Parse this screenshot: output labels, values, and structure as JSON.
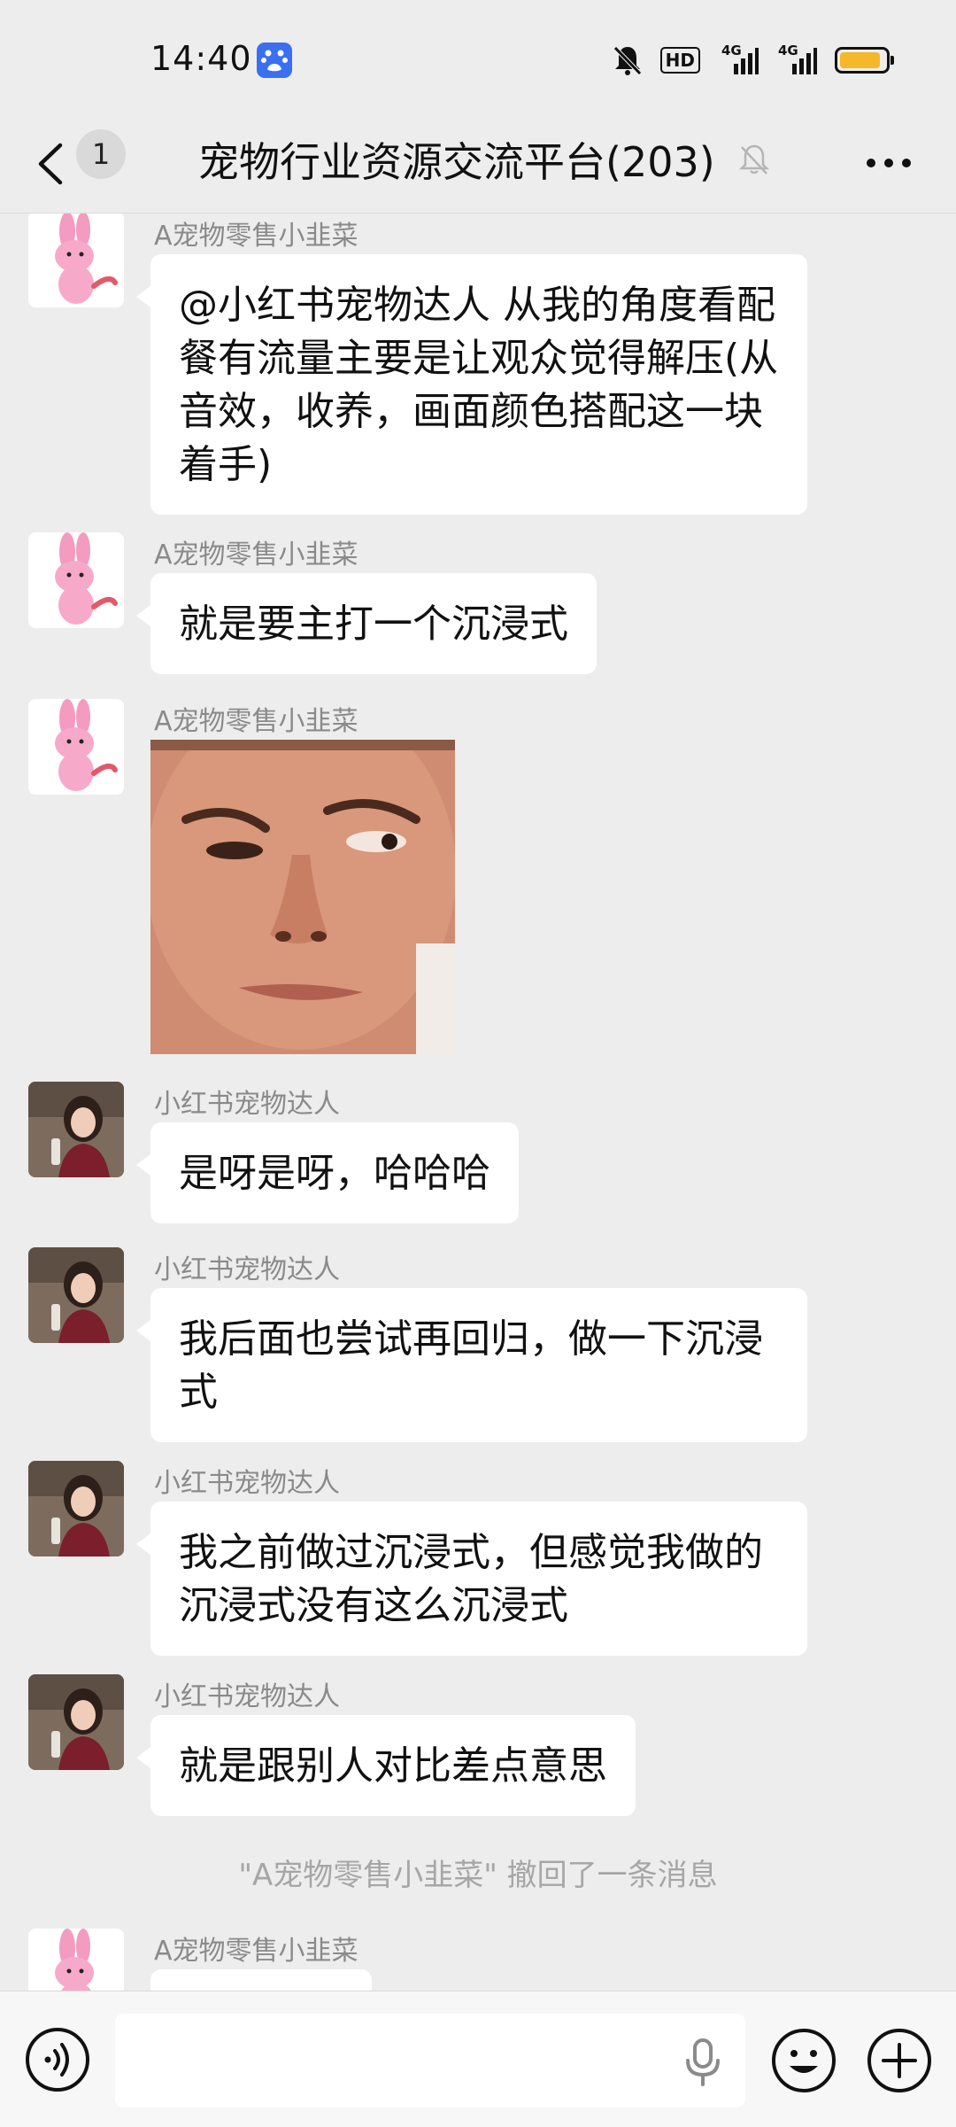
{
  "status_bar": {
    "time": "14:40",
    "hd_label": "HD",
    "network_1": "4G",
    "network_2": "4G",
    "battery_level": 0.9,
    "battery_color": "#f5b82a"
  },
  "header": {
    "unread_count": "1",
    "title": "宠物行业资源交流平台(203)",
    "muted": true
  },
  "messages": [
    {
      "sender": "A宠物零售小韭菜",
      "avatar": "pink-rabbit",
      "text": "@小红书宠物达人  从我的角度看配餐有流量主要是让观众觉得解压(从音效，收养，画面颜色搭配这一块着手)"
    },
    {
      "sender": "A宠物零售小韭菜",
      "avatar": "pink-rabbit",
      "text": "就是要主打一个沉浸式"
    },
    {
      "sender": "A宠物零售小韭菜",
      "avatar": "pink-rabbit",
      "type": "sticker",
      "sticker": "side-eye-face"
    },
    {
      "sender": "小红书宠物达人",
      "avatar": "girl-photo",
      "text": "是呀是呀，哈哈哈"
    },
    {
      "sender": "小红书宠物达人",
      "avatar": "girl-photo",
      "text": "我后面也尝试再回归，做一下沉浸式"
    },
    {
      "sender": "小红书宠物达人",
      "avatar": "girl-photo",
      "text": "我之前做过沉浸式，但感觉我做的沉浸式没有这么沉浸式"
    },
    {
      "sender": "小红书宠物达人",
      "avatar": "girl-photo",
      "text": "就是跟别人对比差点意思"
    },
    {
      "type": "system",
      "text": "\"A宠物零售小韭菜\" 撤回了一条消息"
    },
    {
      "sender": "A宠物零售小韭菜",
      "avatar": "pink-rabbit",
      "text": ""
    }
  ],
  "input_bar": {
    "placeholder": ""
  },
  "colors": {
    "background": "#ededed",
    "bubble": "#ffffff",
    "sender_name": "#8a8a8a",
    "system_text": "#a6a6a6"
  },
  "icons": {
    "back": "chevron-left-icon",
    "mute": "bell-off-icon",
    "more": "more-dots-icon",
    "voice": "voice-icon",
    "mic": "microphone-icon",
    "emoji": "smile-icon",
    "plus": "plus-icon"
  }
}
